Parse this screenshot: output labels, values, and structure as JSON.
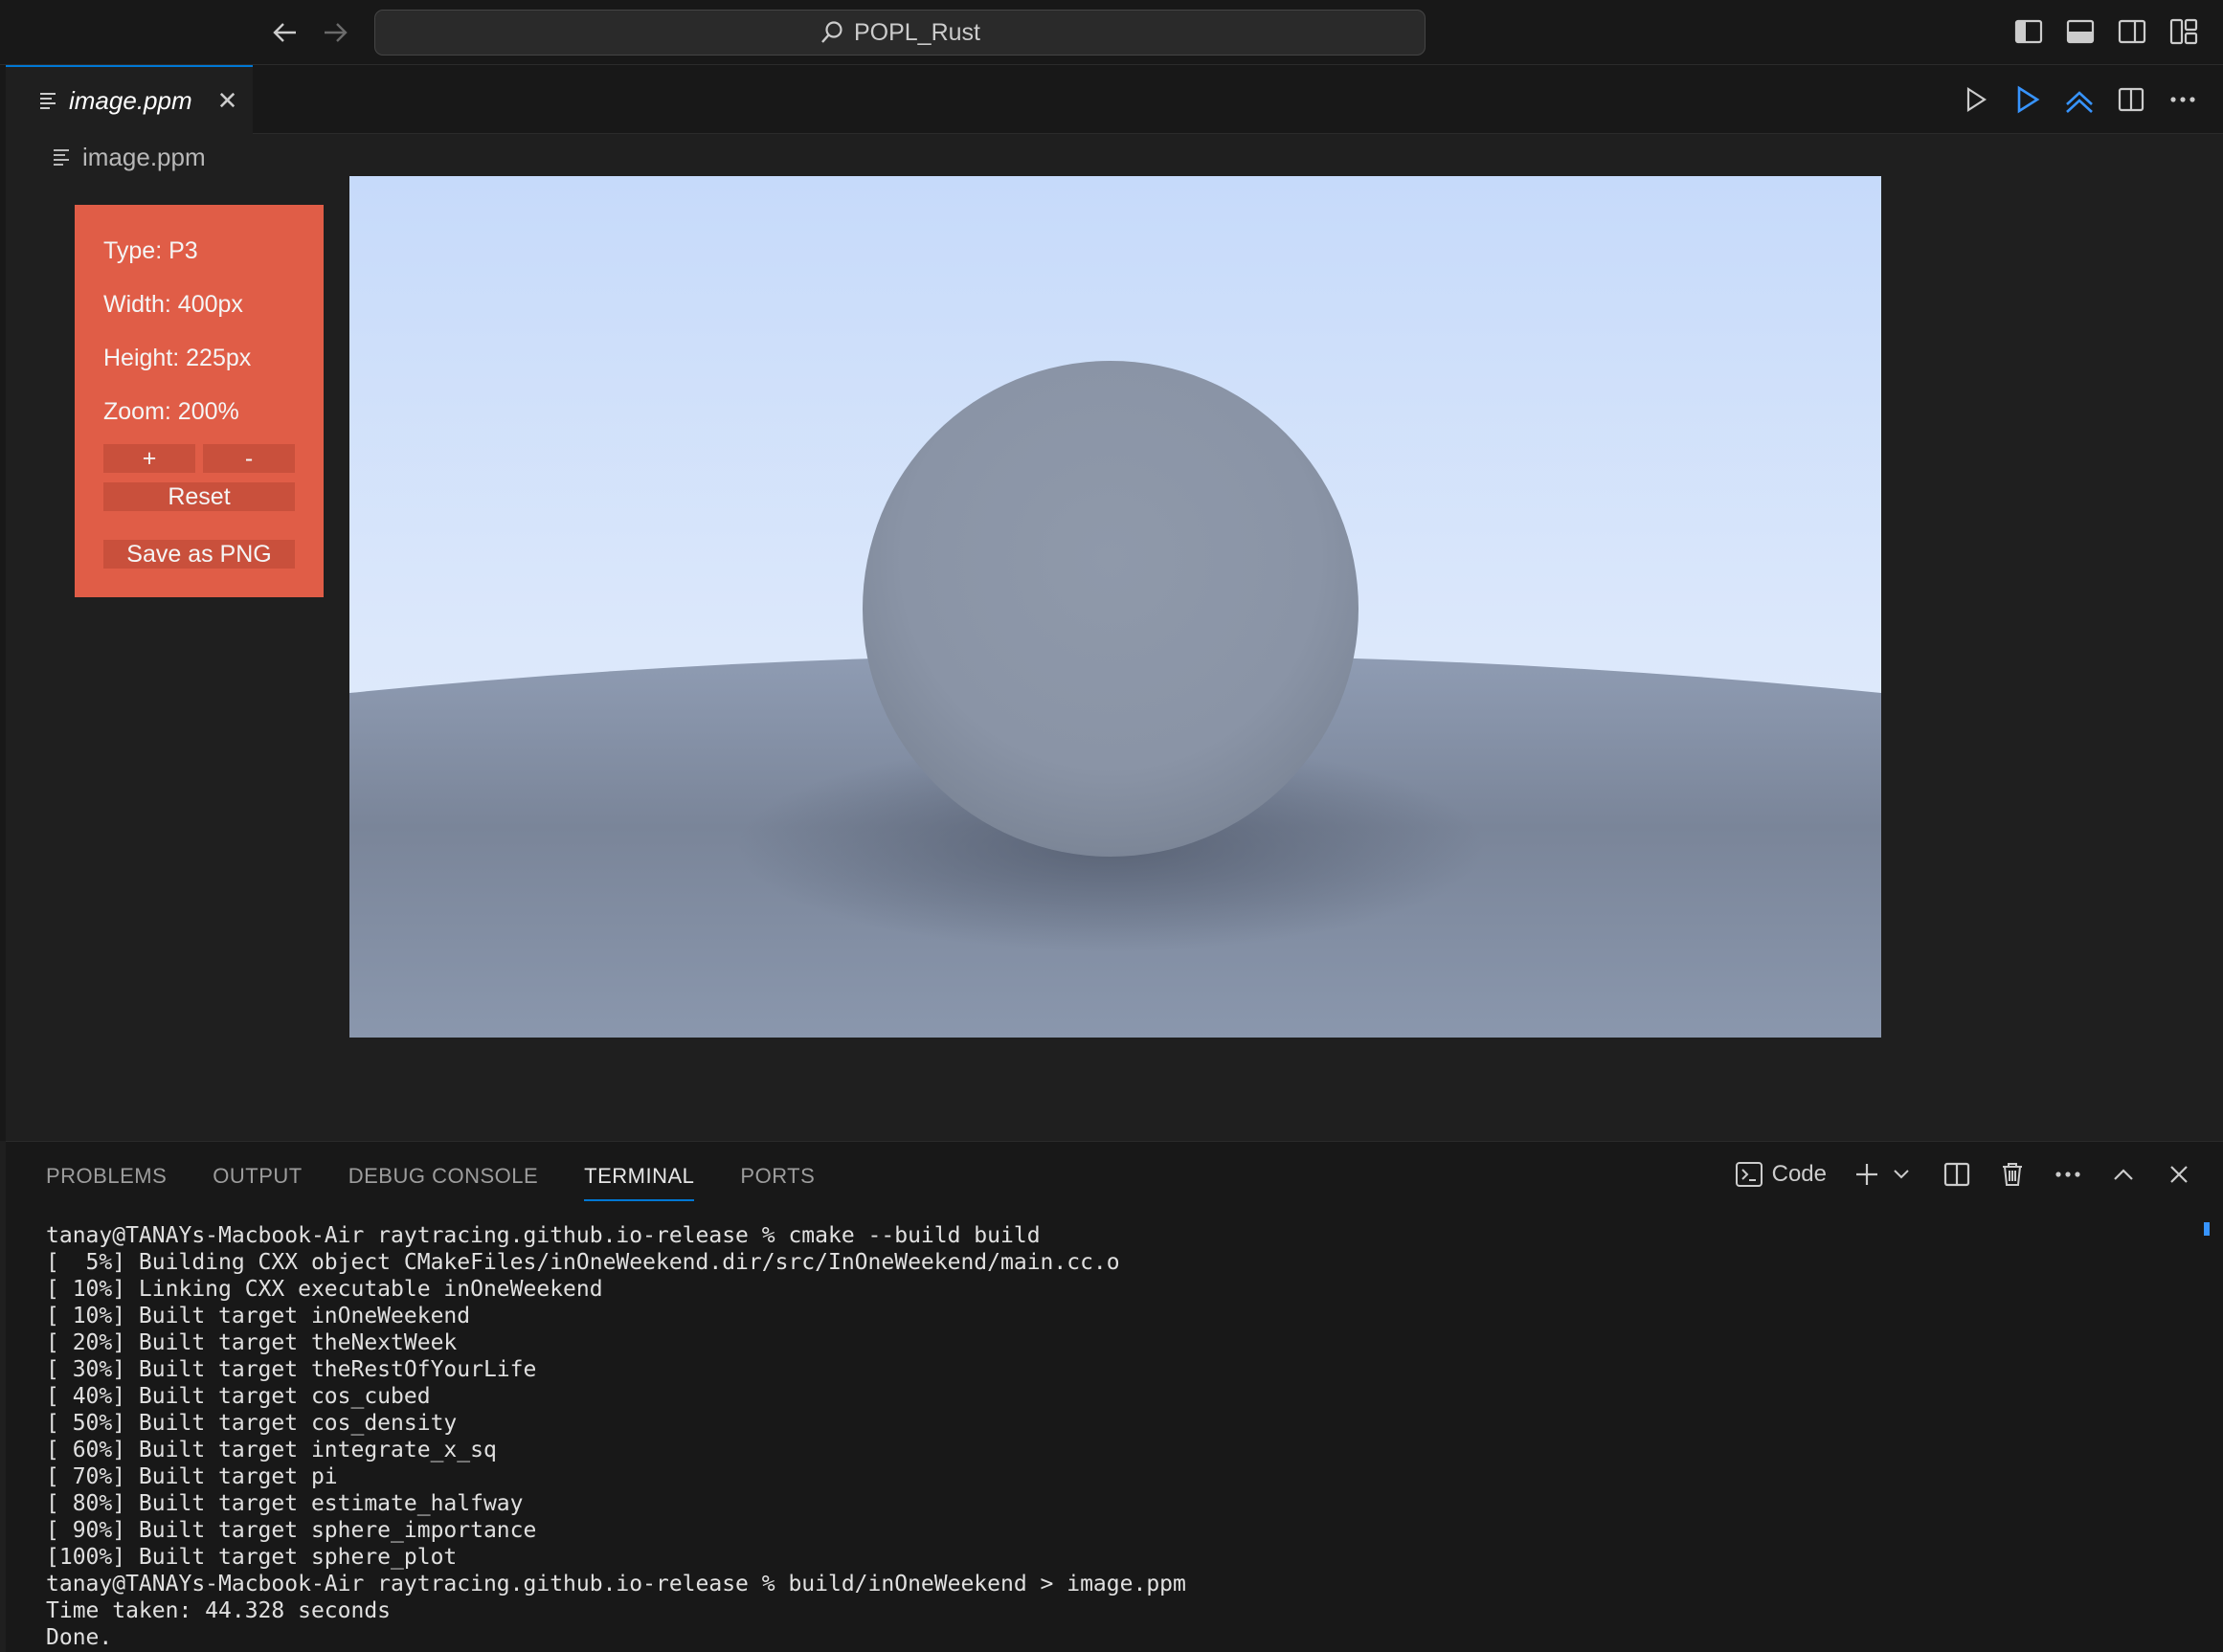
{
  "titlebar": {
    "search_text": "POPL_Rust"
  },
  "tab": {
    "label": "image.ppm",
    "close_glyph": "✕"
  },
  "breadcrumb": {
    "label": "image.ppm"
  },
  "viewer_panel": {
    "type": "Type: P3",
    "width": "Width: 400px",
    "height": "Height: 225px",
    "zoom": "Zoom: 200%",
    "zoom_in_label": "+",
    "zoom_out_label": "-",
    "reset_label": "Reset",
    "save_label": "Save as PNG",
    "accent_color": "#e05d47"
  },
  "panel": {
    "tabs": [
      {
        "label": "PROBLEMS"
      },
      {
        "label": "OUTPUT"
      },
      {
        "label": "DEBUG CONSOLE"
      },
      {
        "label": "TERMINAL"
      },
      {
        "label": "PORTS"
      }
    ],
    "active_tab": "TERMINAL",
    "shell_label": "Code"
  },
  "terminal": {
    "lines": [
      "tanay@TANAYs-Macbook-Air raytracing.github.io-release % cmake --build build",
      "[  5%] Building CXX object CMakeFiles/inOneWeekend.dir/src/InOneWeekend/main.cc.o",
      "[ 10%] Linking CXX executable inOneWeekend",
      "[ 10%] Built target inOneWeekend",
      "[ 20%] Built target theNextWeek",
      "[ 30%] Built target theRestOfYourLife",
      "[ 40%] Built target cos_cubed",
      "[ 50%] Built target cos_density",
      "[ 60%] Built target integrate_x_sq",
      "[ 70%] Built target pi",
      "[ 80%] Built target estimate_halfway",
      "[ 90%] Built target sphere_importance",
      "[100%] Built target sphere_plot",
      "tanay@TANAYs-Macbook-Air raytracing.github.io-release % build/inOneWeekend > image.ppm",
      "Time taken: 44.328 seconds",
      "Done."
    ]
  },
  "colors": {
    "accent": "#0078d4",
    "run_debug_icon": "#3794ff"
  }
}
